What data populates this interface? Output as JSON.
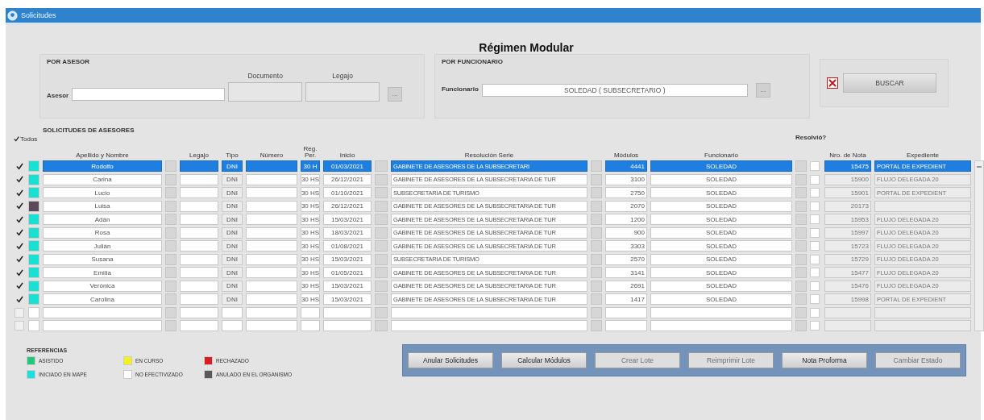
{
  "window": {
    "title": "Solicitudes"
  },
  "heading": "Régimen Modular",
  "asesor_group": {
    "title": "POR ASESOR",
    "asesor_label": "Asesor",
    "documento_label": "Documento",
    "legajo_label": "Legajo",
    "lookup": "..."
  },
  "funcionario_group": {
    "title": "POR FUNCIONARIO",
    "funcionario_label": "Funcionario",
    "funcionario_value": "SOLEDAD ( SUBSECRETARIO )",
    "lookup": "..."
  },
  "search": {
    "clear_checked": true,
    "button": "BUSCAR"
  },
  "table": {
    "title": "SOLICITUDES DE ASESORES",
    "select_all": {
      "label": "Todos",
      "checked": true
    },
    "resolved_header": "Resolvió?",
    "columns": [
      {
        "label": "Apellido y Nombre"
      },
      {
        "label": "Legajo"
      },
      {
        "label": "Tipo"
      },
      {
        "label": "Número"
      },
      {
        "label": "Reg. Per."
      },
      {
        "label": "Inicio"
      },
      {
        "label": "Resolución Serie"
      },
      {
        "label": "Módulos"
      },
      {
        "label": "Funcionario"
      },
      {
        "label": "Nro. de Nota"
      },
      {
        "label": "Expediente"
      }
    ],
    "rows": [
      {
        "kind": "entry",
        "selected": true,
        "checked": true,
        "color": "#19e0d0",
        "name": "Rodolfo",
        "tipo": "DNI",
        "reg_per": "30 H",
        "inicio": "01/03/2021",
        "serie": "GABINETE DE ASESORES DE LA SUBSECRETARI",
        "modulos": "4441",
        "funcionario": "SOLEDAD",
        "resolved": false,
        "nota": "15475",
        "expediente": "PORTAL DE EXPEDIENT"
      },
      {
        "kind": "entry",
        "selected": false,
        "checked": true,
        "color": "#19e0d0",
        "name": "Carina",
        "tipo": "DNI",
        "reg_per": "30 HS",
        "inicio": "26/12/2021",
        "serie": "GABINETE DE ASESORES DE LA SUBSECRETARIA DE TUR",
        "modulos": "3100",
        "funcionario": "SOLEDAD",
        "resolved": false,
        "nota": "15900",
        "expediente": "FLUJO DELEGADA 20"
      },
      {
        "kind": "entry",
        "selected": false,
        "checked": true,
        "color": "#19e0d0",
        "name": "Lucio",
        "tipo": "DNI",
        "reg_per": "30 HS",
        "inicio": "01/10/2021",
        "serie": "SUBSECRETARIA DE TURISMO",
        "modulos": "2750",
        "funcionario": "SOLEDAD",
        "resolved": false,
        "nota": "15901",
        "expediente": "PORTAL DE EXPEDIENT"
      },
      {
        "kind": "entry",
        "selected": false,
        "checked": true,
        "color": "#5a4a5a",
        "name": "Luisa",
        "tipo": "DNI",
        "reg_per": "30 HS",
        "inicio": "26/12/2021",
        "serie": "GABINETE DE ASESORES DE LA SUBSECRETARIA DE TUR",
        "modulos": "2070",
        "funcionario": "SOLEDAD",
        "resolved": false,
        "nota": "20173"
      },
      {
        "kind": "entry",
        "selected": false,
        "checked": true,
        "color": "#19e0d0",
        "name": "Adán",
        "tipo": "DNI",
        "reg_per": "30 HS",
        "inicio": "15/03/2021",
        "serie": "GABINETE DE ASESORES DE LA SUBSECRETARIA DE TUR",
        "modulos": "1200",
        "funcionario": "SOLEDAD",
        "resolved": false,
        "nota": "15953",
        "expediente": "FLUJO DELEGADA 20"
      },
      {
        "kind": "entry",
        "selected": false,
        "checked": true,
        "color": "#19e0d0",
        "name": "Rosa",
        "tipo": "DNI",
        "reg_per": "30 HS",
        "inicio": "18/03/2021",
        "serie": "GABINETE DE ASESORES DE LA SUBSECRETARIA DE TUR",
        "modulos": "900",
        "funcionario": "SOLEDAD",
        "resolved": false,
        "nota": "15997",
        "expediente": "FLUJO DELEGADA 20"
      },
      {
        "kind": "entry",
        "selected": false,
        "checked": true,
        "color": "#19e0d0",
        "name": "Julián",
        "tipo": "DNI",
        "reg_per": "30 HS",
        "inicio": "01/08/2021",
        "serie": "GABINETE DE ASESORES DE LA SUBSECRETARIA DE TUR",
        "modulos": "3303",
        "funcionario": "SOLEDAD",
        "resolved": false,
        "nota": "15723",
        "expediente": "FLUJO DELEGADA 20"
      },
      {
        "kind": "entry",
        "selected": false,
        "checked": true,
        "color": "#19e0d0",
        "name": "Susana",
        "tipo": "DNI",
        "reg_per": "30 HS",
        "inicio": "15/03/2021",
        "serie": "SUBSECRETARIA DE TURISMO",
        "modulos": "2570",
        "funcionario": "SOLEDAD",
        "resolved": false,
        "nota": "15729",
        "expediente": "FLUJO DELEGADA 20"
      },
      {
        "kind": "entry",
        "selected": false,
        "checked": true,
        "color": "#19e0d0",
        "name": "Emilia",
        "tipo": "DNI",
        "reg_per": "30 HS",
        "inicio": "01/05/2021",
        "serie": "GABINETE DE ASESORES DE LA SUBSECRETARIA DE TUR",
        "modulos": "3141",
        "funcionario": "SOLEDAD",
        "resolved": false,
        "nota": "15477",
        "expediente": "FLUJO DELEGADA 20"
      },
      {
        "kind": "entry",
        "selected": false,
        "checked": true,
        "color": "#19e0d0",
        "name": "Verónica",
        "tipo": "DNI",
        "reg_per": "30 HS",
        "inicio": "15/03/2021",
        "serie": "GABINETE DE ASESORES DE LA SUBSECRETARIA DE TUR",
        "modulos": "2691",
        "funcionario": "SOLEDAD",
        "resolved": false,
        "nota": "15476",
        "expediente": "FLUJO DELEGADA 20"
      },
      {
        "kind": "entry",
        "selected": false,
        "checked": true,
        "color": "#19e0d0",
        "name": "Carolina",
        "tipo": "DNI",
        "reg_per": "30 HS",
        "inicio": "15/03/2021",
        "serie": "GABINETE DE ASESORES DE LA SUBSECRETARIA DE TUR",
        "modulos": "1417",
        "funcionario": "SOLEDAD",
        "resolved": false,
        "nota": "15998",
        "expediente": "PORTAL DE EXPEDIENT"
      },
      {
        "kind": "blank",
        "checked": false,
        "resolved": false
      },
      {
        "kind": "blank",
        "checked": false,
        "resolved": false
      }
    ]
  },
  "legend": {
    "title": "REFERENCIAS",
    "items": [
      {
        "label": "ASISTIDO",
        "color": "#22c77a"
      },
      {
        "label": "EN CURSO",
        "color": "#f2f21a"
      },
      {
        "label": "RECHAZADO",
        "color": "#d81e1e"
      },
      {
        "label": "INICIADO EN MAPE",
        "color": "#19e0e0"
      },
      {
        "label": "NO EFECTIVIZADO",
        "color": "#ffffff"
      },
      {
        "label": "ANULADO EN EL ORGANISMO",
        "color": "#5a5a5a"
      }
    ]
  },
  "actions": [
    {
      "label": "Anular Solicitudes",
      "disabled": false
    },
    {
      "label": "Calcular Módulos",
      "disabled": false
    },
    {
      "label": "Crear Lote",
      "disabled": true
    },
    {
      "label": "Reimprimir Lote",
      "disabled": true
    },
    {
      "label": "Nota Proforma",
      "disabled": false
    },
    {
      "label": "Cambiar Estado",
      "disabled": true
    }
  ]
}
